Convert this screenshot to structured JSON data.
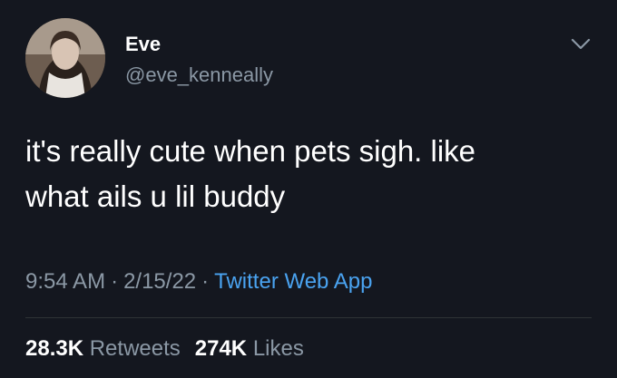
{
  "user": {
    "display_name": "Eve",
    "handle": "@eve_kenneally"
  },
  "tweet": {
    "text": "it's really cute when pets sigh. like\nwhat ails u lil buddy",
    "time": "9:54 AM",
    "date": "2/15/22",
    "separator": "·",
    "source": "Twitter Web App"
  },
  "stats": {
    "retweets_count": "28.3K",
    "retweets_label": "Retweets",
    "likes_count": "274K",
    "likes_label": "Likes"
  },
  "colors": {
    "background": "#14171f",
    "link": "#4aa3f0",
    "secondary_text": "#8b98a5"
  },
  "icons": {
    "more": "chevron-down-icon"
  }
}
